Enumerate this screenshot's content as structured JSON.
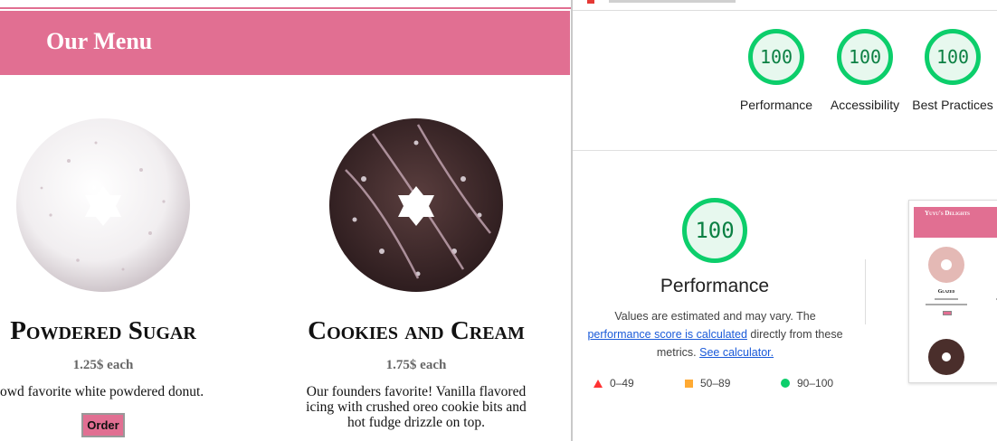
{
  "site": {
    "menu_title": "Our Menu",
    "products": [
      {
        "name": "Powdered Sugar",
        "price": "1.25$ each",
        "description": "rowd favorite white powdered donut.",
        "order_label": "Order"
      },
      {
        "name": "Cookies and Cream",
        "price": "1.75$ each",
        "description": "Our founders favorite! Vanilla flavored icing with crushed oreo cookie bits and hot fudge drizzle on top."
      }
    ]
  },
  "lighthouse": {
    "scores": [
      {
        "value": "100",
        "label": "Performance"
      },
      {
        "value": "100",
        "label": "Accessibility"
      },
      {
        "value": "100",
        "label": "Best Practices"
      }
    ],
    "main_score": "100",
    "main_title": "Performance",
    "desc_text_1": "Values are estimated and may vary. The ",
    "desc_link_1": "performance score is calculated",
    "desc_text_2": " directly from these metrics. ",
    "desc_link_2": "See calculator.",
    "legend": [
      {
        "range": "0–49",
        "shape": "triangle",
        "color": "#ff3333"
      },
      {
        "range": "50–89",
        "shape": "square",
        "color": "#ffaa33"
      },
      {
        "range": "90–100",
        "shape": "circle",
        "color": "#0cce6b"
      }
    ],
    "thumbnail": {
      "site_title": "Yuyu's Delights",
      "item_name": "Glazed"
    }
  },
  "colors": {
    "brand_pink": "#e16f92",
    "score_green": "#0cce6b",
    "link_blue": "#1a5ad9"
  }
}
